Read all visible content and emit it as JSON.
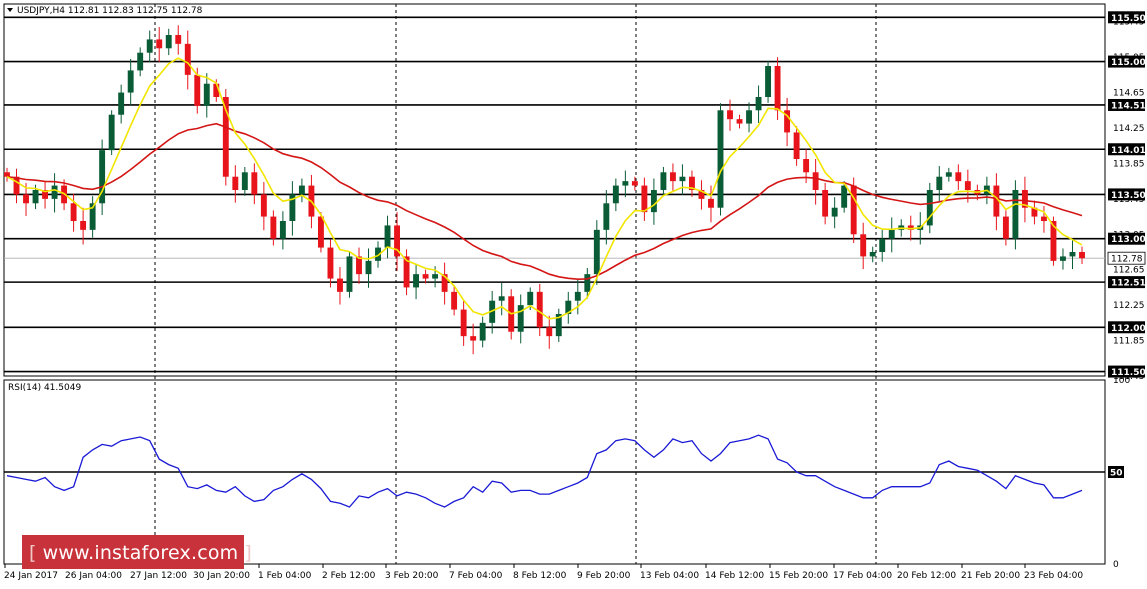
{
  "chart_data": [
    {
      "type": "candlestick",
      "symbol_header": "USDJPY,H4  112.81 112.83 112.75 112.78",
      "ylim": [
        111.45,
        115.65
      ],
      "y_ticks": [
        "115.45",
        "115.05",
        "114.65",
        "114.25",
        "113.85",
        "113.45",
        "113.05",
        "112.65",
        "112.25",
        "111.85",
        "111.45"
      ],
      "levels": [
        "115.50",
        "115.00",
        "114.51",
        "114.01",
        "113.50",
        "113.00",
        "112.51",
        "112.00",
        "111.50"
      ],
      "current_price": "112.78",
      "x_labels": [
        "24 Jan 2017",
        "26 Jan 04:00",
        "27 Jan 12:00",
        "30 Jan 20:00",
        "1 Feb 04:00",
        "2 Feb 12:00",
        "3 Feb 20:00",
        "7 Feb 04:00",
        "8 Feb 12:00",
        "9 Feb 20:00",
        "13 Feb 04:00",
        "14 Feb 12:00",
        "15 Feb 20:00",
        "17 Feb 04:00",
        "20 Feb 12:00",
        "21 Feb 20:00",
        "23 Feb 04:00"
      ],
      "closes": [
        113.7,
        113.5,
        113.4,
        113.55,
        113.45,
        113.6,
        113.4,
        113.2,
        113.1,
        113.4,
        114.0,
        114.4,
        114.65,
        114.9,
        115.1,
        115.25,
        115.15,
        115.3,
        115.2,
        114.85,
        114.5,
        114.75,
        114.6,
        113.7,
        113.55,
        113.75,
        113.5,
        113.25,
        113.0,
        113.2,
        113.5,
        113.6,
        113.25,
        112.9,
        112.55,
        112.4,
        112.8,
        112.6,
        112.75,
        112.9,
        113.15,
        112.8,
        112.45,
        112.6,
        112.55,
        112.6,
        112.4,
        112.2,
        111.9,
        111.85,
        112.05,
        112.3,
        112.35,
        111.95,
        112.25,
        112.4,
        112.0,
        111.9,
        112.15,
        112.3,
        112.4,
        112.6,
        113.1,
        113.4,
        113.6,
        113.65,
        113.6,
        113.3,
        113.55,
        113.75,
        113.65,
        113.7,
        113.55,
        113.45,
        113.35,
        114.45,
        114.35,
        114.3,
        114.45,
        114.6,
        114.95,
        114.45,
        114.2,
        113.9,
        113.75,
        113.55,
        113.25,
        113.35,
        113.6,
        113.05,
        112.8,
        112.85,
        113.0,
        113.1,
        113.15,
        113.1,
        113.15,
        113.55,
        113.7,
        113.75,
        113.65,
        113.55,
        113.5,
        113.6,
        113.25,
        113.0,
        113.55,
        113.35,
        113.25,
        113.2,
        112.75,
        112.8,
        112.85,
        112.78
      ]
    },
    {
      "type": "line",
      "title": "RSI(14) 41.5049",
      "ylim": [
        0,
        100
      ],
      "y_ticks": [
        "100",
        "50",
        "0"
      ],
      "level": "50",
      "values": [
        48,
        47,
        46,
        45,
        47,
        42,
        40,
        42,
        58,
        62,
        65,
        64,
        67,
        68,
        69,
        67,
        57,
        54,
        52,
        42,
        41,
        43,
        40,
        39,
        42,
        37,
        34,
        35,
        40,
        42,
        46,
        49,
        46,
        41,
        34,
        33,
        31,
        37,
        36,
        39,
        41,
        37,
        39,
        38,
        36,
        33,
        31,
        34,
        36,
        42,
        39,
        45,
        44,
        39,
        40,
        40,
        38,
        38,
        40,
        42,
        44,
        47,
        60,
        62,
        67,
        68,
        67,
        62,
        58,
        62,
        68,
        66,
        67,
        60,
        56,
        60,
        66,
        67,
        68,
        70,
        68,
        57,
        55,
        50,
        48,
        48,
        45,
        42,
        40,
        38,
        36,
        36,
        40,
        42,
        42,
        42,
        42,
        44,
        54,
        56,
        53,
        52,
        51,
        48,
        45,
        41,
        48,
        46,
        44,
        43,
        36,
        36,
        38,
        40
      ]
    }
  ],
  "watermark": {
    "url": "www.instaforex.com"
  }
}
